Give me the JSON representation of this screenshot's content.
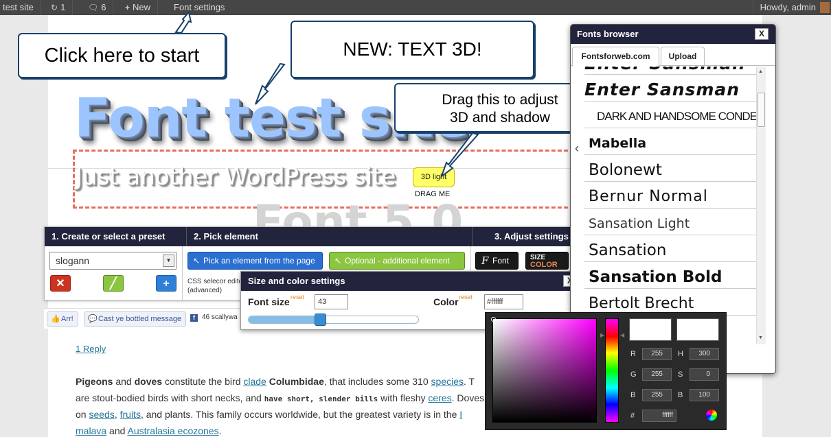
{
  "admin_bar": {
    "site": "test site",
    "updates": "1",
    "comments": "6",
    "new": "New",
    "font_settings": "Font settings",
    "howdy": "Howdy, admin"
  },
  "site": {
    "title": "Font test site",
    "tagline": "Just another WordPress site",
    "ghost_text": "Font 5.0"
  },
  "callouts": {
    "start": "Click here to start",
    "text3d": "NEW: TEXT 3D!",
    "drag_line1": "Drag this to adjust",
    "drag_line2": "3D and shadow"
  },
  "drag_handle": {
    "button": "3D light",
    "caption": "DRAG ME"
  },
  "preset_panel": {
    "step1": "1. Create or select a preset",
    "step2": "2. Pick element",
    "step3": "3. Adjust settings",
    "preset_value": "slogann",
    "pick_button": "Pick an element from the page",
    "optional_button": "Optional - additional element",
    "css_line1": "CSS selecor edito",
    "css_line2": "(advanced)",
    "font_button": "Font",
    "size_label": "SIZE",
    "color_label": "COLOR"
  },
  "size_color": {
    "title": "Size and color settings",
    "close": "X",
    "font_size_label": "Font size",
    "font_size_reset": "reset",
    "font_size_value": "43",
    "slider_level": 0.42,
    "color_label": "Color",
    "color_reset": "reset",
    "color_value": "#ffffff"
  },
  "social": {
    "arr": "Arr!",
    "bottled": "Cast ye bottled message",
    "fb_count": "46 scallywa"
  },
  "fonts_browser": {
    "title": "Fonts browser",
    "close": "X",
    "tabs": [
      "Fontsforweb.com",
      "Upload"
    ],
    "partial_top": "Enter Sansman",
    "fonts": [
      "Enter Sansman",
      "DARK AND HANDSOME CONDENSED",
      "Mabella",
      "Bolonewt",
      "Bernur Normal",
      "Sansation Light",
      "Sansation",
      "Sansation Bold",
      "Bertolt Brecht"
    ]
  },
  "color_picker": {
    "R": "255",
    "G": "255",
    "B": "255",
    "H": "300",
    "S": "0",
    "Bv": "100",
    "hex_label": "#",
    "hex": "ffffff",
    "colors": {
      "hue_top": "#ff00ff",
      "selected": "#ffffff"
    }
  },
  "article": {
    "reply": "1 Reply",
    "w1": "Pigeons",
    "w2": " and ",
    "w3": "doves",
    "w4": " constitute the bird ",
    "clade": "clade",
    "w5": " ",
    "w6": "Columbidae",
    "w7": ", that includes some 310 ",
    "species": "species",
    "w8": ". T",
    "l2a": "are stout-bodied birds with short necks, and ",
    "l2b": "have short, slender bills",
    "l2c": " with fleshy ",
    "ceres": "ceres",
    "l2d": ". Doves f",
    "l3a": "on ",
    "seeds": "seeds",
    "c1": ", ",
    "fruits": "fruits",
    "l3b": ", and plants. This family occurs worldwide, but the greatest variety is in the ",
    "ind": "I",
    "l4a": "malava",
    "l4b": " and ",
    "aus": "Australasia ecozones",
    "l4c": "."
  }
}
